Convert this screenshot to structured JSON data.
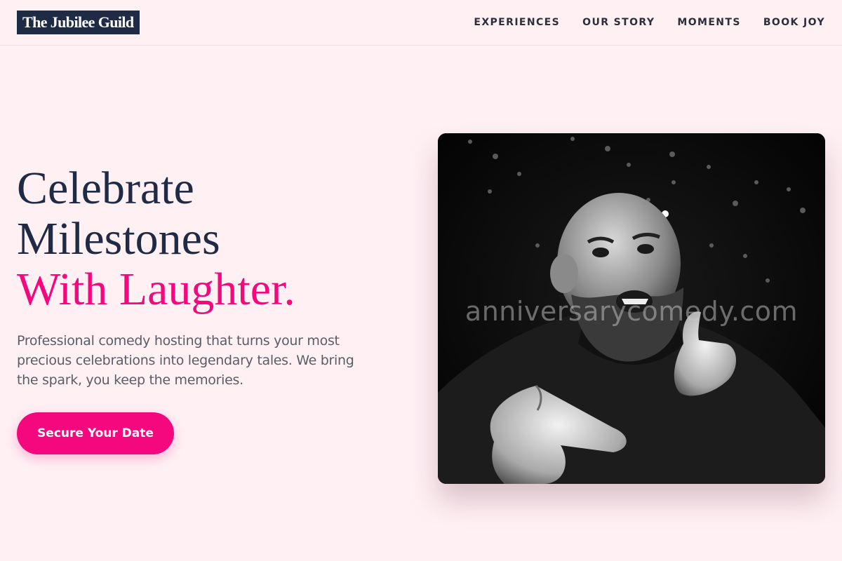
{
  "header": {
    "logo_text": "The Jubilee Guild",
    "nav": [
      {
        "label": "EXPERIENCES"
      },
      {
        "label": "OUR STORY"
      },
      {
        "label": "MOMENTS"
      },
      {
        "label": "BOOK JOY"
      }
    ]
  },
  "hero": {
    "title_line1": "Celebrate",
    "title_line2": "Milestones",
    "title_accent": "With Laughter.",
    "description": "Professional comedy hosting that turns your most precious celebrations into legendary tales. We bring the spark, you keep the memories.",
    "cta_label": "Secure Your Date"
  },
  "photo": {
    "watermark": "anniversarycomedy.com",
    "subject": "black-and-white photo of a bald bearded comedian pointing at the camera"
  },
  "colors": {
    "background": "#fff0f4",
    "navy": "#1f2b45",
    "accent": "#f5087e"
  }
}
